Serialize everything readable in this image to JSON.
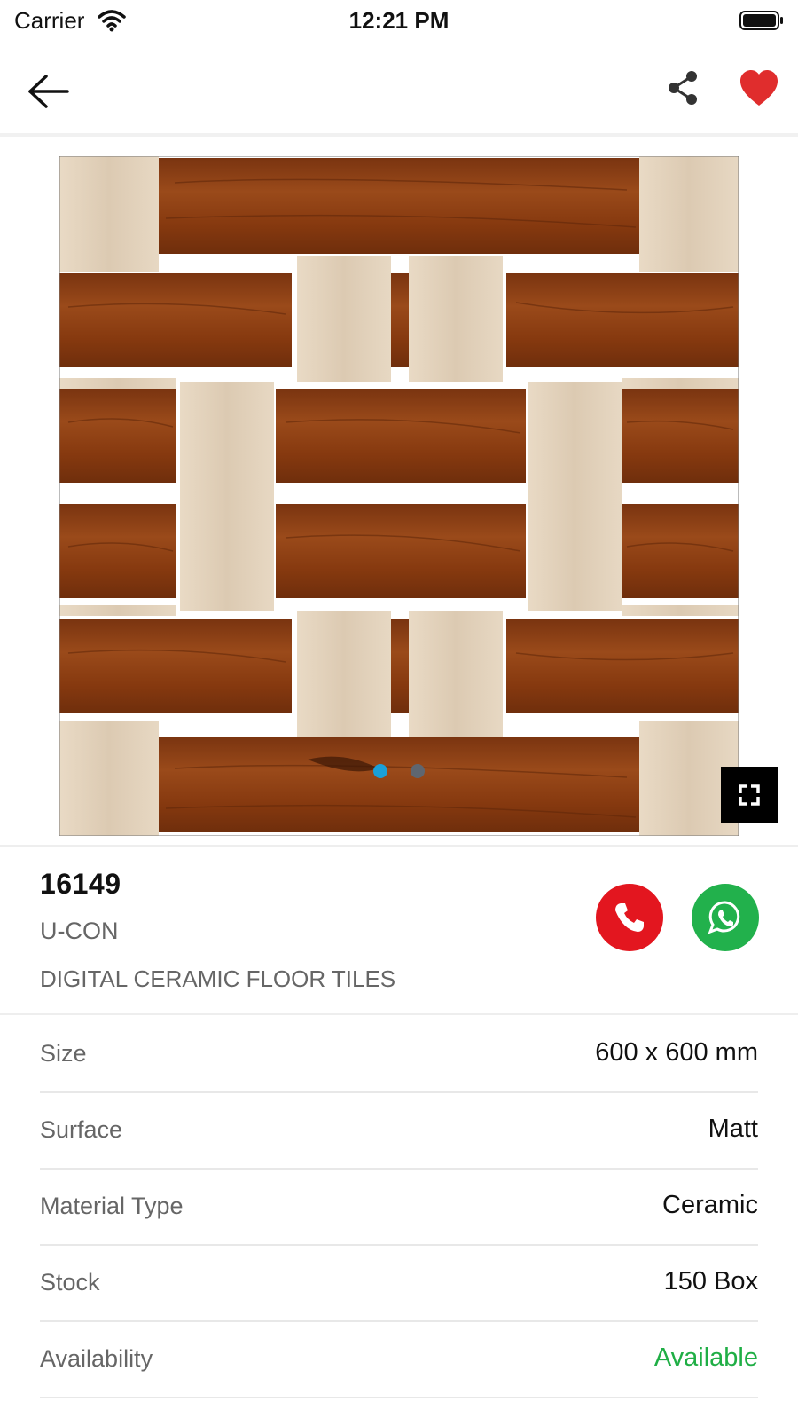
{
  "status_bar": {
    "carrier": "Carrier",
    "time": "12:21 PM"
  },
  "carousel": {
    "slide_count": 2,
    "active_index": 0,
    "dot_active_color": "#1aa0d8",
    "dot_inactive_color": "#5f6670"
  },
  "product": {
    "id": "16149",
    "brand": "U-CON",
    "category": "DIGITAL CERAMIC FLOOR TILES"
  },
  "specs": [
    {
      "label": "Size",
      "value": "600 x 600 mm"
    },
    {
      "label": "Surface",
      "value": "Matt"
    },
    {
      "label": "Material Type",
      "value": "Ceramic"
    },
    {
      "label": "Stock",
      "value": "150 Box"
    },
    {
      "label": "Availability",
      "value": "Available"
    }
  ],
  "colors": {
    "favorite": "#e02d2d",
    "call": "#e3161f",
    "whatsapp": "#22b14c",
    "available": "#1fae45",
    "dark_wood": "#8a3d12",
    "light_wood": "#e6d6c0"
  },
  "icons": {
    "back": "arrow-left",
    "share": "share-nodes",
    "favorite": "heart-filled",
    "fullscreen": "expand-corners",
    "call": "phone",
    "whatsapp": "whatsapp"
  }
}
